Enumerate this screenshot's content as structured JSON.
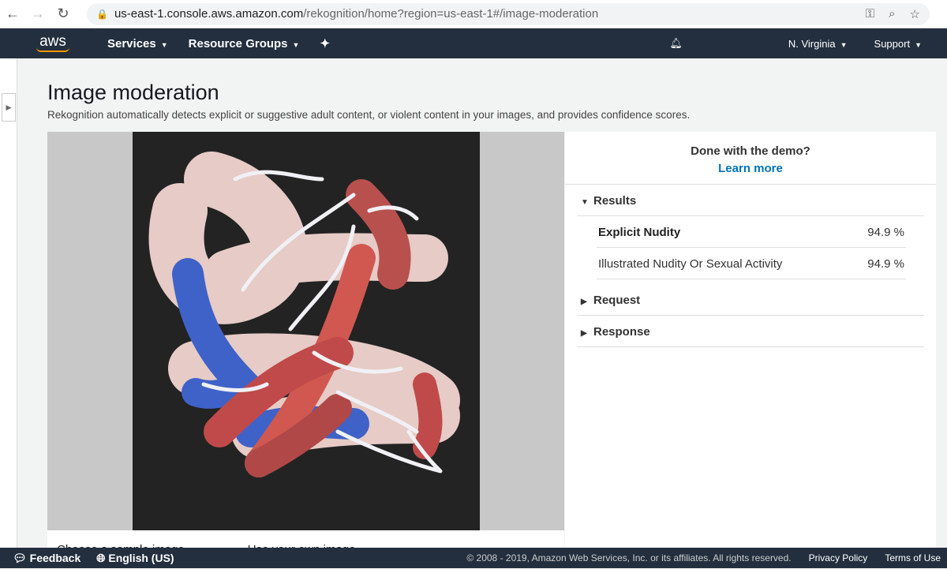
{
  "browser": {
    "url_host": "us-east-1.console.aws.amazon.com",
    "url_path": "/rekognition/home?region=us-east-1#/image-moderation"
  },
  "topnav": {
    "logo": "aws",
    "services": "Services",
    "resource_groups": "Resource Groups",
    "region": "N. Virginia",
    "support": "Support"
  },
  "page": {
    "title": "Image moderation",
    "description": "Rekognition automatically detects explicit or suggestive adult content, or violent content in your images, and provides confidence scores.",
    "choose_sample": "Choose a sample image",
    "use_own": "Use your own image"
  },
  "panel": {
    "done_text": "Done with the demo?",
    "learn_more": "Learn more",
    "results_label": "Results",
    "results": [
      {
        "label": "Explicit Nudity",
        "value": "94.9 %"
      },
      {
        "label": "Illustrated Nudity Or Sexual Activity",
        "value": "94.9 %"
      }
    ],
    "request_label": "Request",
    "response_label": "Response"
  },
  "footer": {
    "feedback": "Feedback",
    "language": "English (US)",
    "copyright": "© 2008 - 2019, Amazon Web Services, Inc. or its affiliates. All rights reserved.",
    "privacy": "Privacy Policy",
    "terms": "Terms of Use"
  }
}
